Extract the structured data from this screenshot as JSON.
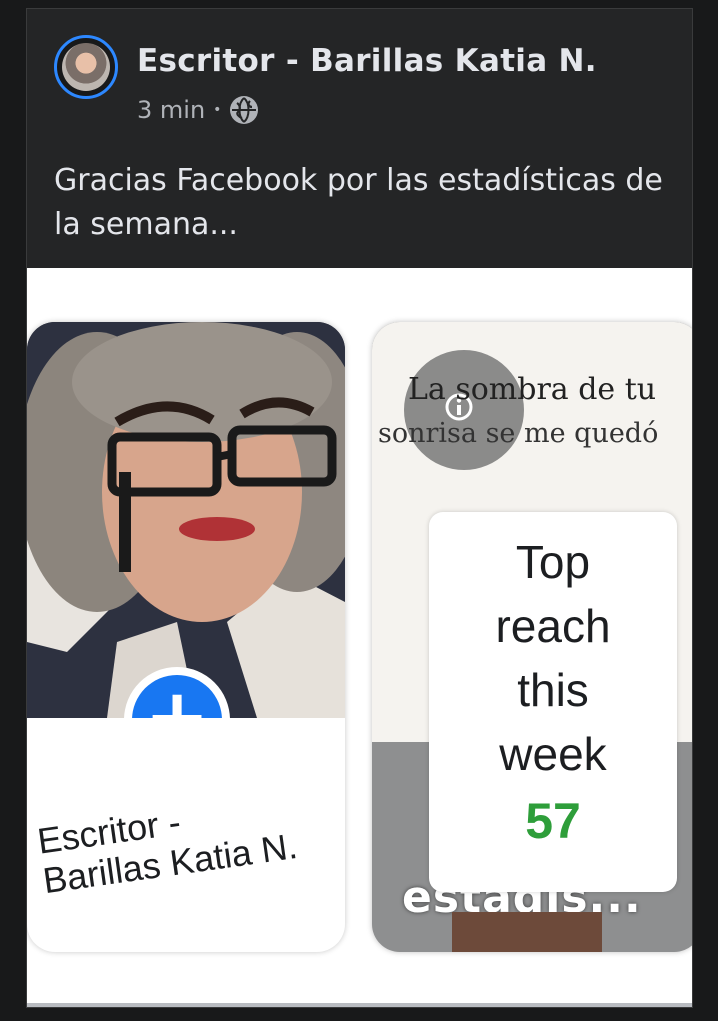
{
  "post": {
    "author": "Escritor - Barillas Katia N.",
    "time": "3 min",
    "separator": "•",
    "audience_icon": "globe-icon",
    "caption": "Gracias Facebook por las estadísticas de la semana..."
  },
  "shared": {
    "profile_card": {
      "name_line1": "Escritor -",
      "name_line2": "Barillas Katia N.",
      "action_icon": "plus-icon"
    },
    "stats_card": {
      "background_text_1": "La sombra de tu",
      "background_text_2": "sonrisa se me quedó",
      "info_icon": "info-icon",
      "label_line1": "Top",
      "label_line2": "reach",
      "label_line3": "this",
      "label_line4": "week",
      "count": "57",
      "overlay_text": "estadis..."
    }
  },
  "colors": {
    "background": "#18191a",
    "post_bg": "#242526",
    "accent_blue": "#1877f2",
    "count_green": "#2e9e3a"
  }
}
